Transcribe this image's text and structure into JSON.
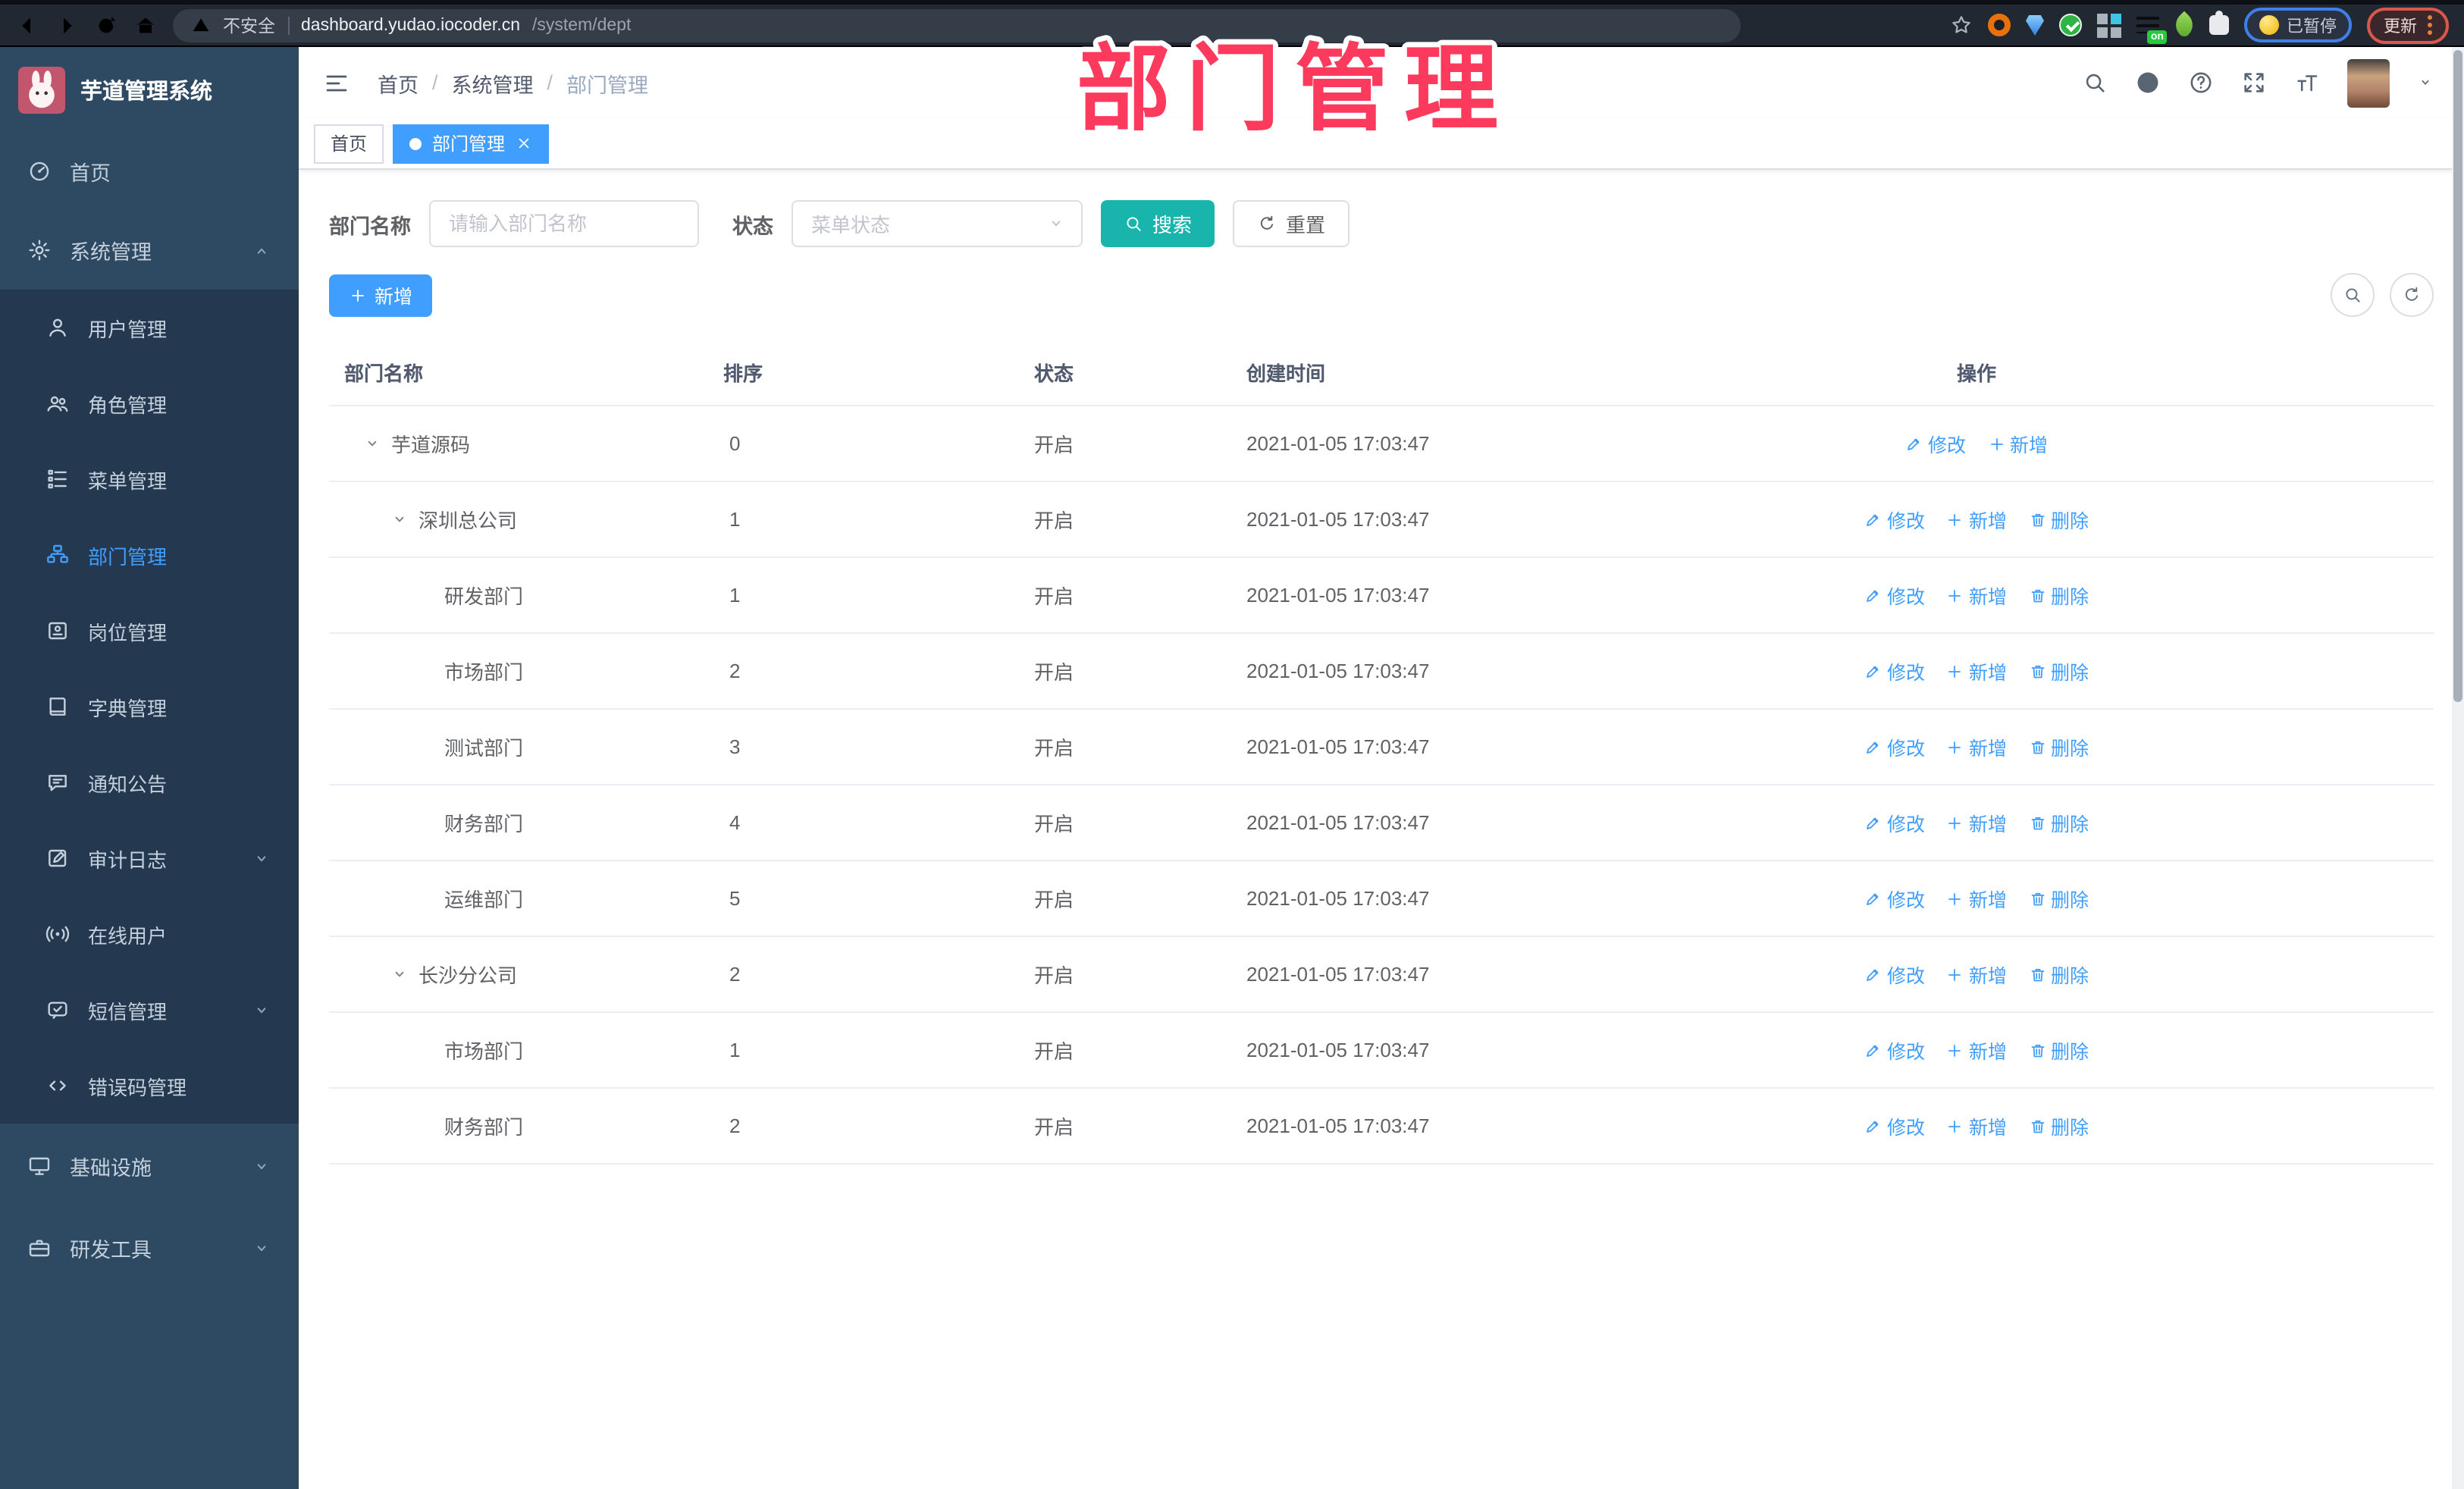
{
  "colors": {
    "primary": "#409eff",
    "search-button": "#19b5ac",
    "annotation": "#fb3a5d",
    "sidebar-bg": "#2e4a63",
    "submenu-bg": "#24394f"
  },
  "annotation": {
    "text": "部门管理"
  },
  "browser": {
    "insecure_label": "不安全",
    "url_domain": "dashboard.yudao.iocoder.cn",
    "url_path": "/system/dept",
    "extension_badge": "on",
    "paused_label": "已暂停",
    "update_label": "更新"
  },
  "app": {
    "title": "芋道管理系统"
  },
  "sidebar": {
    "items": [
      {
        "key": "home",
        "label": "首页",
        "icon": "home",
        "type": "top"
      },
      {
        "key": "system",
        "label": "系统管理",
        "icon": "gear",
        "type": "top",
        "chevron": "up",
        "expanded": true
      },
      {
        "key": "users",
        "label": "用户管理",
        "icon": "user",
        "type": "sub"
      },
      {
        "key": "roles",
        "label": "角色管理",
        "icon": "users",
        "type": "sub"
      },
      {
        "key": "menus",
        "label": "菜单管理",
        "icon": "menu-tree",
        "type": "sub"
      },
      {
        "key": "depts",
        "label": "部门管理",
        "icon": "dept",
        "type": "sub",
        "active": true
      },
      {
        "key": "posts",
        "label": "岗位管理",
        "icon": "post",
        "type": "sub"
      },
      {
        "key": "dicts",
        "label": "字典管理",
        "icon": "dict",
        "type": "sub"
      },
      {
        "key": "notices",
        "label": "通知公告",
        "icon": "notice",
        "type": "sub"
      },
      {
        "key": "audit-logs",
        "label": "审计日志",
        "icon": "log",
        "type": "sub",
        "chevron": "down"
      },
      {
        "key": "online",
        "label": "在线用户",
        "icon": "online",
        "type": "sub"
      },
      {
        "key": "sms",
        "label": "短信管理",
        "icon": "sms",
        "type": "sub",
        "chevron": "down"
      },
      {
        "key": "error-codes",
        "label": "错误码管理",
        "icon": "code",
        "type": "sub"
      },
      {
        "key": "infra",
        "label": "基础设施",
        "icon": "infra",
        "type": "top",
        "chevron": "down"
      },
      {
        "key": "dev-tools",
        "label": "研发工具",
        "icon": "tools",
        "type": "top",
        "chevron": "down"
      }
    ]
  },
  "header": {
    "breadcrumb": [
      "首页",
      "系统管理",
      "部门管理"
    ],
    "separator": "/"
  },
  "tabs": [
    {
      "key": "home",
      "label": "首页",
      "active": false
    },
    {
      "key": "dept",
      "label": "部门管理",
      "active": true,
      "closable": true
    }
  ],
  "filters": {
    "dept_label": "部门名称",
    "dept_placeholder": "请输入部门名称",
    "status_label": "状态",
    "status_placeholder": "菜单状态",
    "search_label": "搜索",
    "reset_label": "重置"
  },
  "toolbar": {
    "add_label": "新增"
  },
  "table": {
    "columns": [
      "部门名称",
      "排序",
      "状态",
      "创建时间",
      "操作"
    ],
    "action_labels": {
      "modify": "修改",
      "add": "新增",
      "delete": "删除"
    },
    "rows": [
      {
        "level": 0,
        "caret": true,
        "name": "芋道源码",
        "sort": "0",
        "status": "开启",
        "time": "2021-01-05 17:03:47",
        "actions": [
          "modify",
          "add"
        ]
      },
      {
        "level": 1,
        "caret": true,
        "name": "深圳总公司",
        "sort": "1",
        "status": "开启",
        "time": "2021-01-05 17:03:47",
        "actions": [
          "modify",
          "add",
          "delete"
        ]
      },
      {
        "level": 2,
        "caret": false,
        "name": "研发部门",
        "sort": "1",
        "status": "开启",
        "time": "2021-01-05 17:03:47",
        "actions": [
          "modify",
          "add",
          "delete"
        ]
      },
      {
        "level": 2,
        "caret": false,
        "name": "市场部门",
        "sort": "2",
        "status": "开启",
        "time": "2021-01-05 17:03:47",
        "actions": [
          "modify",
          "add",
          "delete"
        ]
      },
      {
        "level": 2,
        "caret": false,
        "name": "测试部门",
        "sort": "3",
        "status": "开启",
        "time": "2021-01-05 17:03:47",
        "actions": [
          "modify",
          "add",
          "delete"
        ]
      },
      {
        "level": 2,
        "caret": false,
        "name": "财务部门",
        "sort": "4",
        "status": "开启",
        "time": "2021-01-05 17:03:47",
        "actions": [
          "modify",
          "add",
          "delete"
        ]
      },
      {
        "level": 2,
        "caret": false,
        "name": "运维部门",
        "sort": "5",
        "status": "开启",
        "time": "2021-01-05 17:03:47",
        "actions": [
          "modify",
          "add",
          "delete"
        ]
      },
      {
        "level": 1,
        "caret": true,
        "name": "长沙分公司",
        "sort": "2",
        "status": "开启",
        "time": "2021-01-05 17:03:47",
        "actions": [
          "modify",
          "add",
          "delete"
        ]
      },
      {
        "level": 2,
        "caret": false,
        "name": "市场部门",
        "sort": "1",
        "status": "开启",
        "time": "2021-01-05 17:03:47",
        "actions": [
          "modify",
          "add",
          "delete"
        ]
      },
      {
        "level": 2,
        "caret": false,
        "name": "财务部门",
        "sort": "2",
        "status": "开启",
        "time": "2021-01-05 17:03:47",
        "actions": [
          "modify",
          "add",
          "delete"
        ]
      }
    ]
  }
}
